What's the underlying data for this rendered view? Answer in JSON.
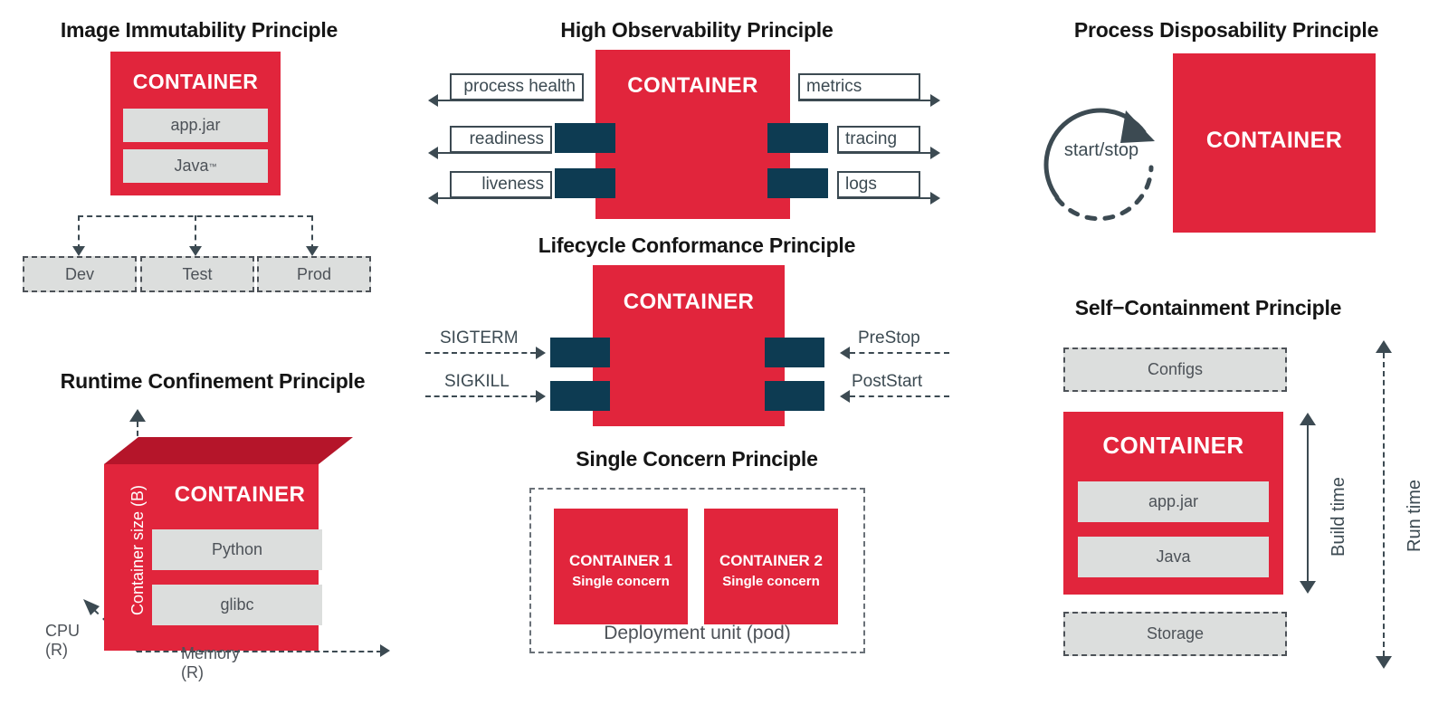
{
  "colors": {
    "red": "#E1253C",
    "dark_red": "#B5152A",
    "teal": "#0D3B52",
    "gray_fill": "#DCDEDD",
    "gray_stroke": "#4D5258",
    "line": "#3C4A52",
    "title": "#151515"
  },
  "panels": {
    "image_immutability": {
      "title": "Image Immutability Principle",
      "container_label": "CONTAINER",
      "layers": [
        {
          "label": "app.jar"
        },
        {
          "label": "Java",
          "sup": "™"
        }
      ],
      "environments": [
        {
          "label": "Dev"
        },
        {
          "label": "Test"
        },
        {
          "label": "Prod"
        }
      ]
    },
    "high_observability": {
      "title": "High Observability Principle",
      "container_label": "CONTAINER",
      "left_probes": [
        {
          "label": "process health"
        },
        {
          "label": "readiness"
        },
        {
          "label": "liveness"
        }
      ],
      "right_probes": [
        {
          "label": "metrics"
        },
        {
          "label": "tracing"
        },
        {
          "label": "logs"
        }
      ]
    },
    "lifecycle_conformance": {
      "title": "Lifecycle Conformance Principle",
      "container_label": "CONTAINER",
      "left_signals": [
        {
          "label": "SIGTERM"
        },
        {
          "label": "SIGKILL"
        }
      ],
      "right_hooks": [
        {
          "label": "PreStop"
        },
        {
          "label": "PostStart"
        }
      ]
    },
    "single_concern": {
      "title": "Single Concern Principle",
      "pod_label": "Deployment unit (pod)",
      "containers": [
        {
          "title": "CONTAINER 1",
          "subtitle": "Single concern"
        },
        {
          "title": "CONTAINER 2",
          "subtitle": "Single concern"
        }
      ]
    },
    "process_disposability": {
      "title": "Process Disposability Principle",
      "cycle_label": "start/stop",
      "container_label": "CONTAINER"
    },
    "runtime_confinement": {
      "title": "Runtime Confinement Principle",
      "container_label": "CONTAINER",
      "y_axis_label": "Container size (B)",
      "x_axis_label": "Memory (R)",
      "z_axis_label": "CPU (R)",
      "layers": [
        {
          "label": "Python"
        },
        {
          "label": "glibc"
        }
      ]
    },
    "self_containment": {
      "title": "Self−Containment Principle",
      "container_label": "CONTAINER",
      "top_box": {
        "label": "Configs"
      },
      "bottom_box": {
        "label": "Storage"
      },
      "layers": [
        {
          "label": "app.jar"
        },
        {
          "label": "Java"
        }
      ],
      "build_time_label": "Build time",
      "run_time_label": "Run time"
    }
  }
}
